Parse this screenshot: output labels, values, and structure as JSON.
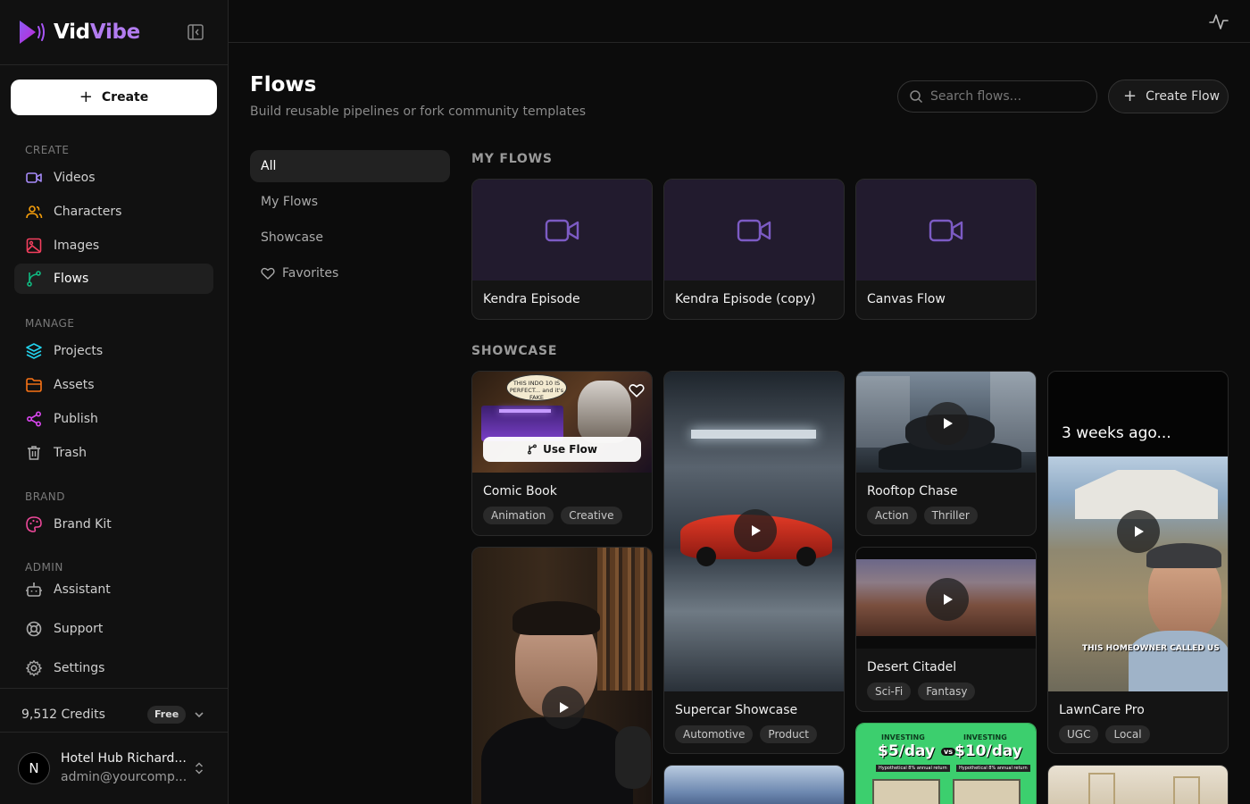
{
  "brand": {
    "name_part1": "Vid",
    "name_part2": "Vibe",
    "accent": "#a855f7"
  },
  "sidebar": {
    "create_label": "Create",
    "sections": [
      {
        "title": "CREATE",
        "items": [
          {
            "label": "Videos",
            "icon": "video-icon",
            "color": "#a78bfa"
          },
          {
            "label": "Characters",
            "icon": "users-icon",
            "color": "#f59e0b"
          },
          {
            "label": "Images",
            "icon": "image-icon",
            "color": "#f43f5e"
          },
          {
            "label": "Flows",
            "icon": "flow-icon",
            "color": "#10b981",
            "active": true
          }
        ]
      },
      {
        "title": "MANAGE",
        "items": [
          {
            "label": "Projects",
            "icon": "layers-icon",
            "color": "#22d3ee"
          },
          {
            "label": "Assets",
            "icon": "folder-icon",
            "color": "#f97316"
          },
          {
            "label": "Publish",
            "icon": "share-icon",
            "color": "#d946ef"
          },
          {
            "label": "Trash",
            "icon": "trash-icon",
            "color": "#9ca3af"
          }
        ]
      },
      {
        "title": "BRAND",
        "items": [
          {
            "label": "Brand Kit",
            "icon": "palette-icon",
            "color": "#ec4899"
          }
        ]
      },
      {
        "title": "ADMIN",
        "items": [
          {
            "label": "Assistant",
            "icon": "bot-icon",
            "color": "#9ca3af"
          },
          {
            "label": "Support",
            "icon": "lifebuoy-icon",
            "color": "#9ca3af"
          },
          {
            "label": "Settings",
            "icon": "gear-icon",
            "color": "#9ca3af"
          }
        ]
      }
    ],
    "credits": "9,512 Credits",
    "plan_badge": "Free",
    "user": {
      "initial": "N",
      "name": "Hotel Hub Richard...",
      "email": "admin@yourcomp..."
    }
  },
  "header": {
    "title": "Flows",
    "subtitle": "Build reusable pipelines or fork community templates",
    "search_placeholder": "Search flows...",
    "create_flow_label": "Create Flow"
  },
  "filters": [
    {
      "label": "All",
      "active": true
    },
    {
      "label": "My Flows"
    },
    {
      "label": "Showcase"
    },
    {
      "label": "Favorites",
      "icon": "heart-icon"
    }
  ],
  "my_flows": {
    "label": "MY FLOWS",
    "items": [
      {
        "title": "Kendra Episode"
      },
      {
        "title": "Kendra Episode (copy)"
      },
      {
        "title": "Canvas Flow"
      }
    ]
  },
  "showcase": {
    "label": "SHOWCASE",
    "use_flow_label": "Use Flow",
    "items": [
      {
        "title": "Comic Book",
        "tags": [
          "Animation",
          "Creative"
        ],
        "bubble": "THIS INDO 10 IS PERFECT... and it's FAKE"
      },
      {
        "title": "Supercar Showcase",
        "tags": [
          "Automotive",
          "Product"
        ]
      },
      {
        "title": "Rooftop Chase",
        "tags": [
          "Action",
          "Thriller"
        ]
      },
      {
        "title": "LawnCare Pro",
        "tags": [
          "UGC",
          "Local"
        ],
        "overlay_top": "3 weeks ago...",
        "overlay_bottom": "THIS HOMEOWNER CALLED US"
      },
      {
        "title": "Desert Citadel",
        "tags": [
          "Sci-Fi",
          "Fantasy"
        ]
      }
    ],
    "investing": {
      "label": "INVESTING",
      "left": "$5/day",
      "vs": "vs",
      "right": "$10/day",
      "note": "Hypothetical 8% annual return"
    }
  }
}
